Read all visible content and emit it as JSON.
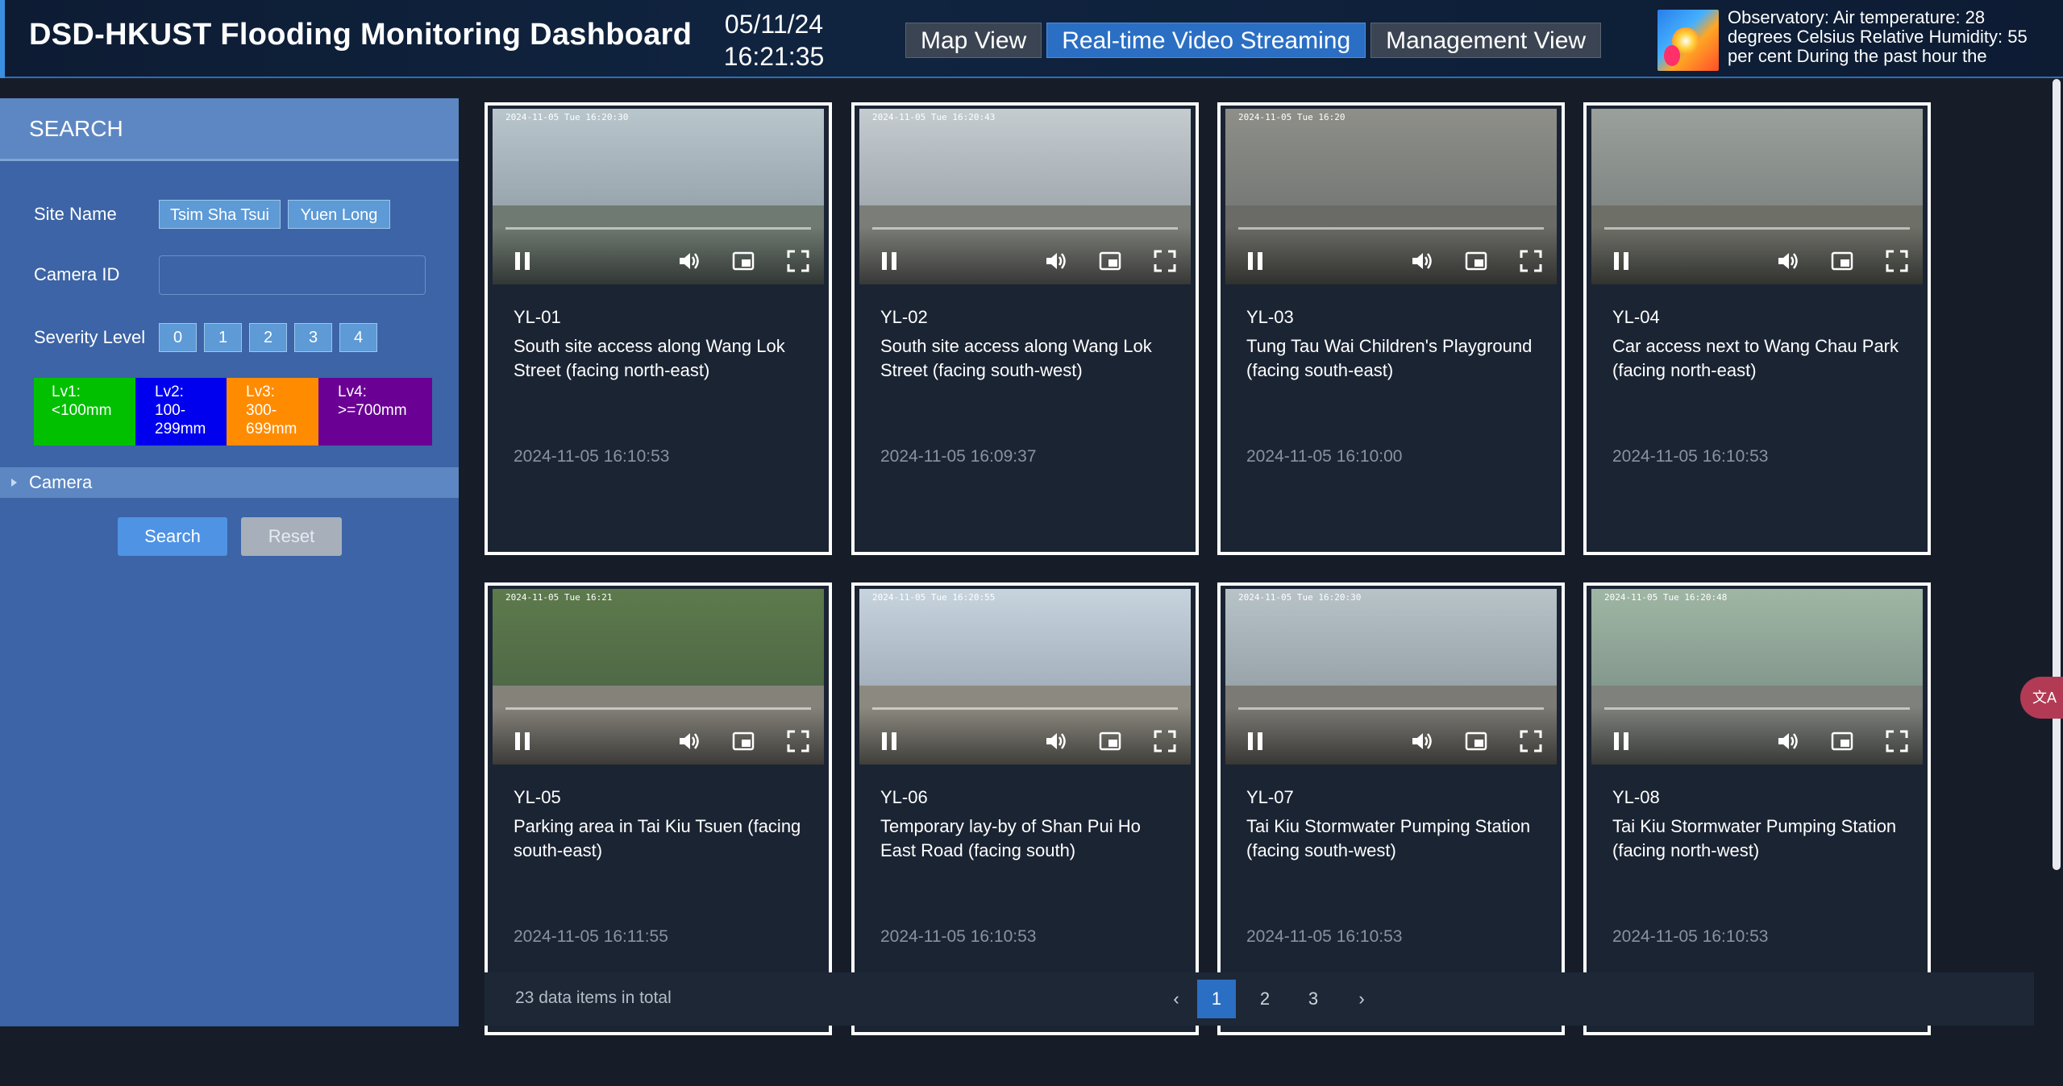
{
  "header": {
    "title": "DSD-HKUST Flooding Monitoring Dashboard",
    "date": "05/11/24",
    "time": "16:21:35",
    "nav": [
      {
        "label": "Map View"
      },
      {
        "label": "Real-time Video Streaming",
        "active": true
      },
      {
        "label": "Management View"
      }
    ],
    "weather_text": "Observatory: Air temperature: 28 degrees Celsius Relative Humidity: 55 per cent During the past hour the"
  },
  "sidebar": {
    "heading": "SEARCH",
    "site_name_label": "Site Name",
    "sites": [
      "Tsim Sha Tsui",
      "Yuen Long"
    ],
    "camera_id_label": "Camera ID",
    "camera_id_value": "",
    "severity_label": "Severity Level",
    "severity_levels": [
      "0",
      "1",
      "2",
      "3",
      "4"
    ],
    "legend": [
      {
        "label": "Lv1:",
        "range": "<100mm",
        "color": "#00c000"
      },
      {
        "label": "Lv2:",
        "range": "100-299mm",
        "color": "#0000ee"
      },
      {
        "label": "Lv3:",
        "range": "300-699mm",
        "color": "#ff8c00"
      },
      {
        "label": "Lv4:",
        "range": ">=700mm",
        "color": "#6a0094"
      }
    ],
    "camera_section": "Camera",
    "search_label": "Search",
    "reset_label": "Reset"
  },
  "cameras": [
    {
      "id": "YL-01",
      "description": "South site access along Wang Lok Street (facing north-east)",
      "time": "2024-11-05 16:10:53",
      "overlay": "2024-11-05 Tue 16:20:30"
    },
    {
      "id": "YL-02",
      "description": "South site access along Wang Lok Street (facing south-west)",
      "time": "2024-11-05 16:09:37",
      "overlay": "2024-11-05 Tue 16:20:43"
    },
    {
      "id": "YL-03",
      "description": "Tung Tau Wai Children's Playground (facing south-east)",
      "time": "2024-11-05 16:10:00",
      "overlay": "2024-11-05 Tue 16:20"
    },
    {
      "id": "YL-04",
      "description": "Car access next to Wang Chau Park (facing north-east)",
      "time": "2024-11-05 16:10:53",
      "overlay": ""
    },
    {
      "id": "YL-05",
      "description": "Parking area in Tai Kiu Tsuen (facing south-east)",
      "time": "2024-11-05 16:11:55",
      "overlay": "2024-11-05 Tue 16:21"
    },
    {
      "id": "YL-06",
      "description": "Temporary lay-by of Shan Pui Ho East Road (facing south)",
      "time": "2024-11-05 16:10:53",
      "overlay": "2024-11-05 Tue 16:20:55"
    },
    {
      "id": "YL-07",
      "description": "Tai Kiu Stormwater Pumping Station (facing south-west)",
      "time": "2024-11-05 16:10:53",
      "overlay": "2024-11-05 Tue 16:20:30"
    },
    {
      "id": "YL-08",
      "description": "Tai Kiu Stormwater Pumping Station (facing north-west)",
      "time": "2024-11-05 16:10:53",
      "overlay": "2024-11-05 Tue 16:20:48"
    }
  ],
  "pagination": {
    "total_text": "23 data items in total",
    "pages": [
      "1",
      "2",
      "3"
    ],
    "current": "1",
    "prev": "‹",
    "next": "›"
  },
  "icons": {
    "pause": "pause-icon",
    "volume": "volume-icon",
    "pip": "picture-in-picture-icon",
    "fullscreen": "fullscreen-icon",
    "translate": "translate-icon"
  },
  "colors": {
    "accent": "#2b6fc4",
    "sidebar": "#3c64a6",
    "card": "#1b2433",
    "background": "#161d29"
  }
}
